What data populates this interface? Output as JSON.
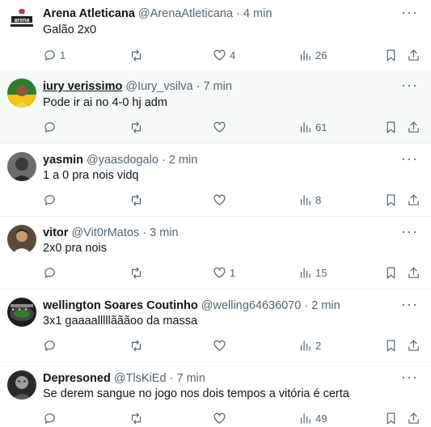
{
  "colors": {
    "text": "#0f1419",
    "muted": "#536471",
    "divider": "#eff3f4",
    "highlight": "#f7f9f9"
  },
  "icons": {
    "reply": "reply-icon",
    "retweet": "retweet-icon",
    "like": "heart-icon",
    "views": "views-bars-icon",
    "bookmark": "bookmark-icon",
    "share": "share-icon",
    "more": "more-dots-icon"
  },
  "tweets": [
    {
      "name": "Arena Atleticana",
      "handle": "@ArenaAtleticana",
      "sep": "·",
      "time": "4 min",
      "text": "Galão 2x0",
      "replies": "1",
      "retweets": "",
      "likes": "4",
      "views": "26"
    },
    {
      "name": "iury verissimo",
      "handle": "@Iury_vsilva",
      "sep": "·",
      "time": "7 min",
      "text": "Pode ir ai no 4-0 hj adm",
      "replies": "",
      "retweets": "",
      "likes": "",
      "views": "61"
    },
    {
      "name": "yasmin",
      "handle": "@yaasdogalo",
      "sep": "·",
      "time": "2 min",
      "text": "1 a 0 pra nois vidq",
      "replies": "",
      "retweets": "",
      "likes": "",
      "views": "8"
    },
    {
      "name": "vitor",
      "handle": "@Vit0rMatos",
      "sep": "·",
      "time": "3 min",
      "text": "2x0 pra nois",
      "replies": "",
      "retweets": "",
      "likes": "1",
      "views": "15"
    },
    {
      "name": "wellington Soares Coutinho",
      "handle": "@welling64636070",
      "sep": "·",
      "time": "2 min",
      "text": "3x1 gaaaalllllãããoo da massa",
      "replies": "",
      "retweets": "",
      "likes": "",
      "views": "2"
    },
    {
      "name": "Depresoned",
      "handle": "@TlsKiEd",
      "sep": "·",
      "time": "7 min",
      "text": "Se derem sangue no jogo nos dois tempos a vitória é certa",
      "replies": "",
      "retweets": "",
      "likes": "",
      "views": "49"
    }
  ]
}
